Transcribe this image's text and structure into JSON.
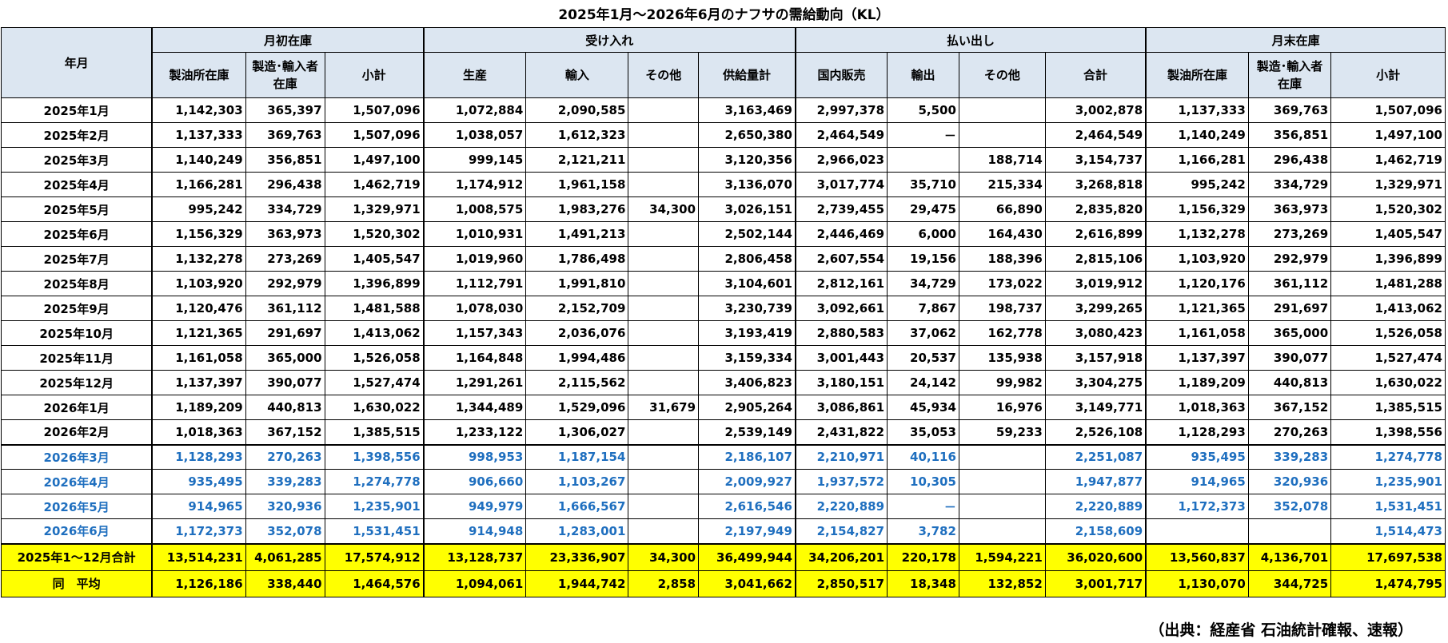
{
  "title": "2025年1月～2026年6月のナフサの需給動向（KL）",
  "source_note": "（出典：経産省 石油統計確報、速報）",
  "header": {
    "ym": "年月",
    "groups": [
      "月初在庫",
      "受け入れ",
      "払い出し",
      "月末在庫"
    ],
    "columns": [
      "製油所在庫",
      "製造･輸入者在庫",
      "小計",
      "生産",
      "輸入",
      "その他",
      "供給量計",
      "国内販売",
      "輸出",
      "その他",
      "合計",
      "製油所在庫",
      "製造･輸入者在庫",
      "小計"
    ]
  },
  "rows": [
    {
      "label": "2025年1月",
      "cells": [
        "1,142,303",
        "365,397",
        "1,507,096",
        "1,072,884",
        "2,090,585",
        "",
        "3,163,469",
        "2,997,378",
        "5,500",
        "",
        "3,002,878",
        "1,137,333",
        "369,763",
        "1,507,096"
      ]
    },
    {
      "label": "2025年2月",
      "cells": [
        "1,137,333",
        "369,763",
        "1,507,096",
        "1,038,057",
        "1,612,323",
        "",
        "2,650,380",
        "2,464,549",
        "－",
        "",
        "2,464,549",
        "1,140,249",
        "356,851",
        "1,497,100"
      ]
    },
    {
      "label": "2025年3月",
      "cells": [
        "1,140,249",
        "356,851",
        "1,497,100",
        "999,145",
        "2,121,211",
        "",
        "3,120,356",
        "2,966,023",
        "",
        "188,714",
        "3,154,737",
        "1,166,281",
        "296,438",
        "1,462,719"
      ]
    },
    {
      "label": "2025年4月",
      "cells": [
        "1,166,281",
        "296,438",
        "1,462,719",
        "1,174,912",
        "1,961,158",
        "",
        "3,136,070",
        "3,017,774",
        "35,710",
        "215,334",
        "3,268,818",
        "995,242",
        "334,729",
        "1,329,971"
      ]
    },
    {
      "label": "2025年5月",
      "cells": [
        "995,242",
        "334,729",
        "1,329,971",
        "1,008,575",
        "1,983,276",
        "34,300",
        "3,026,151",
        "2,739,455",
        "29,475",
        "66,890",
        "2,835,820",
        "1,156,329",
        "363,973",
        "1,520,302"
      ]
    },
    {
      "label": "2025年6月",
      "cells": [
        "1,156,329",
        "363,973",
        "1,520,302",
        "1,010,931",
        "1,491,213",
        "",
        "2,502,144",
        "2,446,469",
        "6,000",
        "164,430",
        "2,616,899",
        "1,132,278",
        "273,269",
        "1,405,547"
      ]
    },
    {
      "label": "2025年7月",
      "cells": [
        "1,132,278",
        "273,269",
        "1,405,547",
        "1,019,960",
        "1,786,498",
        "",
        "2,806,458",
        "2,607,554",
        "19,156",
        "188,396",
        "2,815,106",
        "1,103,920",
        "292,979",
        "1,396,899"
      ]
    },
    {
      "label": "2025年8月",
      "cells": [
        "1,103,920",
        "292,979",
        "1,396,899",
        "1,112,791",
        "1,991,810",
        "",
        "3,104,601",
        "2,812,161",
        "34,729",
        "173,022",
        "3,019,912",
        "1,120,176",
        "361,112",
        "1,481,288"
      ]
    },
    {
      "label": "2025年9月",
      "cells": [
        "1,120,476",
        "361,112",
        "1,481,588",
        "1,078,030",
        "2,152,709",
        "",
        "3,230,739",
        "3,092,661",
        "7,867",
        "198,737",
        "3,299,265",
        "1,121,365",
        "291,697",
        "1,413,062"
      ]
    },
    {
      "label": "2025年10月",
      "cells": [
        "1,121,365",
        "291,697",
        "1,413,062",
        "1,157,343",
        "2,036,076",
        "",
        "3,193,419",
        "2,880,583",
        "37,062",
        "162,778",
        "3,080,423",
        "1,161,058",
        "365,000",
        "1,526,058"
      ]
    },
    {
      "label": "2025年11月",
      "cells": [
        "1,161,058",
        "365,000",
        "1,526,058",
        "1,164,848",
        "1,994,486",
        "",
        "3,159,334",
        "3,001,443",
        "20,537",
        "135,938",
        "3,157,918",
        "1,137,397",
        "390,077",
        "1,527,474"
      ]
    },
    {
      "label": "2025年12月",
      "cells": [
        "1,137,397",
        "390,077",
        "1,527,474",
        "1,291,261",
        "2,115,562",
        "",
        "3,406,823",
        "3,180,151",
        "24,142",
        "99,982",
        "3,304,275",
        "1,189,209",
        "440,813",
        "1,630,022"
      ]
    },
    {
      "label": "2026年1月",
      "cells": [
        "1,189,209",
        "440,813",
        "1,630,022",
        "1,344,489",
        "1,529,096",
        "31,679",
        "2,905,264",
        "3,086,861",
        "45,934",
        "16,976",
        "3,149,771",
        "1,018,363",
        "367,152",
        "1,385,515"
      ]
    },
    {
      "label": "2026年2月",
      "cells": [
        "1,018,363",
        "367,152",
        "1,385,515",
        "1,233,122",
        "1,306,027",
        "",
        "2,539,149",
        "2,431,822",
        "35,053",
        "59,233",
        "2,526,108",
        "1,128,293",
        "270,263",
        "1,398,556"
      ]
    },
    {
      "label": "2026年3月",
      "cells": [
        "1,128,293",
        "270,263",
        "1,398,556",
        "998,953",
        "1,187,154",
        "",
        "2,186,107",
        "2,210,971",
        "40,116",
        "",
        "2,251,087",
        "935,495",
        "339,283",
        "1,274,778"
      ]
    },
    {
      "label": "2026年4月",
      "cells": [
        "935,495",
        "339,283",
        "1,274,778",
        "906,660",
        "1,103,267",
        "",
        "2,009,927",
        "1,937,572",
        "10,305",
        "",
        "1,947,877",
        "914,965",
        "320,936",
        "1,235,901"
      ]
    },
    {
      "label": "2026年5月",
      "cells": [
        "914,965",
        "320,936",
        "1,235,901",
        "949,979",
        "1,666,567",
        "",
        "2,616,546",
        "2,220,889",
        "－",
        "",
        "2,220,889",
        "1,172,373",
        "352,078",
        "1,531,451"
      ]
    },
    {
      "label": "2026年6月",
      "cells": [
        "1,172,373",
        "352,078",
        "1,531,451",
        "914,948",
        "1,283,001",
        "",
        "2,197,949",
        "2,154,827",
        "3,782",
        "",
        "2,158,609",
        "",
        "",
        "1,514,473"
      ]
    }
  ],
  "totals": [
    {
      "label": "2025年1～12月合計",
      "cells": [
        "13,514,231",
        "4,061,285",
        "17,574,912",
        "13,128,737",
        "23,336,907",
        "34,300",
        "36,499,944",
        "34,206,201",
        "220,178",
        "1,594,221",
        "36,020,600",
        "13,560,837",
        "4,136,701",
        "17,697,538"
      ]
    },
    {
      "label": "同　平均",
      "cells": [
        "1,126,186",
        "338,440",
        "1,464,576",
        "1,094,061",
        "1,944,742",
        "2,858",
        "3,041,662",
        "2,850,517",
        "18,348",
        "132,852",
        "3,001,717",
        "1,130,070",
        "344,725",
        "1,474,795"
      ]
    }
  ],
  "colors": {
    "header_bg": "#dce6f1",
    "projection_text": "#1f6fbf",
    "total_bg": "#ffff00"
  }
}
